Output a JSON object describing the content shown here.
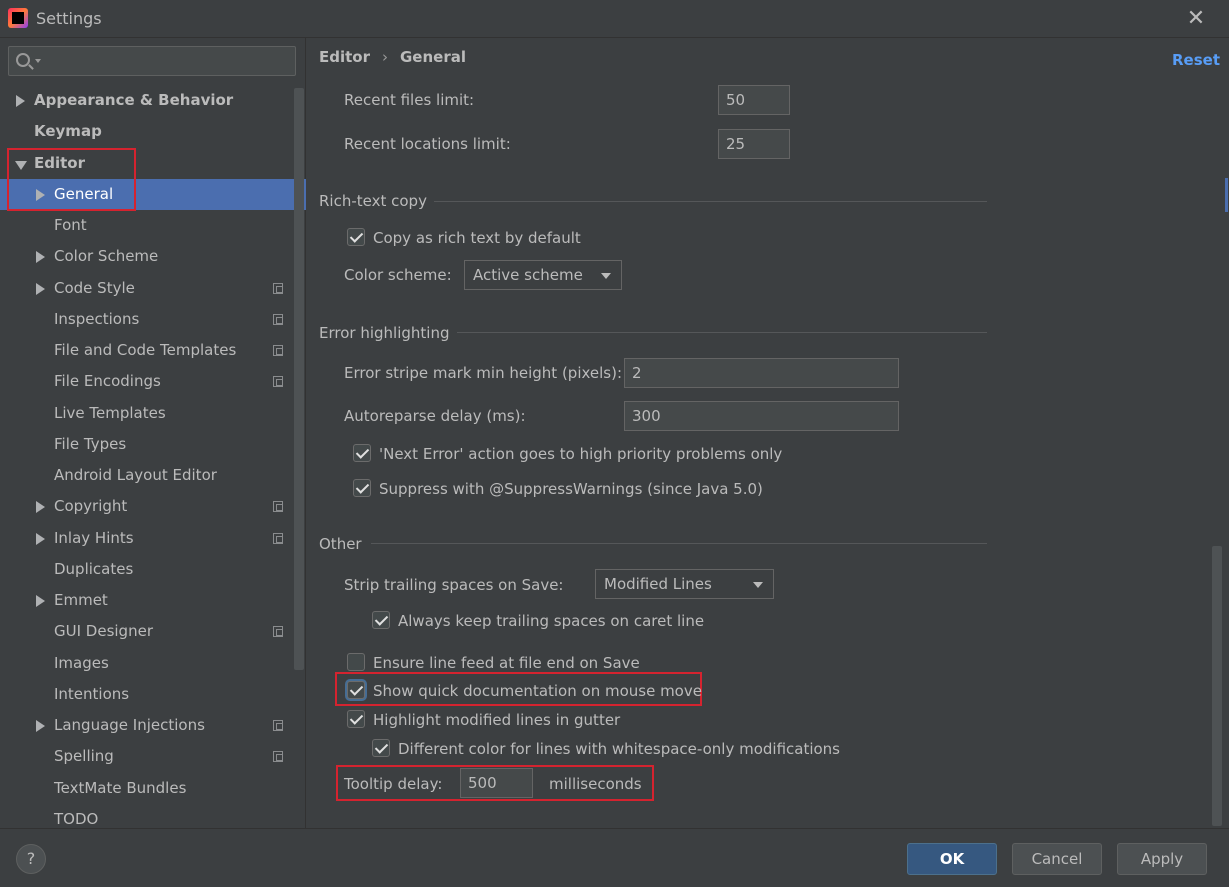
{
  "window": {
    "title": "Settings",
    "close_glyph": "✕",
    "logo": "intellij-logo"
  },
  "search": {
    "value": "",
    "placeholder": ""
  },
  "sidebar": {
    "items": [
      {
        "label": "Appearance & Behavior",
        "depth": 0,
        "bold": true,
        "arrow": "right"
      },
      {
        "label": "Keymap",
        "depth": 0,
        "bold": true,
        "arrow": "none"
      },
      {
        "label": "Editor",
        "depth": 0,
        "bold": true,
        "arrow": "down"
      },
      {
        "label": "General",
        "depth": 1,
        "arrow": "right",
        "selected": true
      },
      {
        "label": "Font",
        "depth": 1,
        "arrow": "none"
      },
      {
        "label": "Color Scheme",
        "depth": 1,
        "arrow": "right"
      },
      {
        "label": "Code Style",
        "depth": 1,
        "arrow": "right",
        "copy": true
      },
      {
        "label": "Inspections",
        "depth": 1,
        "arrow": "none",
        "copy": true
      },
      {
        "label": "File and Code Templates",
        "depth": 1,
        "arrow": "none",
        "copy": true
      },
      {
        "label": "File Encodings",
        "depth": 1,
        "arrow": "none",
        "copy": true
      },
      {
        "label": "Live Templates",
        "depth": 1,
        "arrow": "none"
      },
      {
        "label": "File Types",
        "depth": 1,
        "arrow": "none"
      },
      {
        "label": "Android Layout Editor",
        "depth": 1,
        "arrow": "none"
      },
      {
        "label": "Copyright",
        "depth": 1,
        "arrow": "right",
        "copy": true
      },
      {
        "label": "Inlay Hints",
        "depth": 1,
        "arrow": "right",
        "copy": true
      },
      {
        "label": "Duplicates",
        "depth": 1,
        "arrow": "none"
      },
      {
        "label": "Emmet",
        "depth": 1,
        "arrow": "right"
      },
      {
        "label": "GUI Designer",
        "depth": 1,
        "arrow": "none",
        "copy": true
      },
      {
        "label": "Images",
        "depth": 1,
        "arrow": "none"
      },
      {
        "label": "Intentions",
        "depth": 1,
        "arrow": "none"
      },
      {
        "label": "Language Injections",
        "depth": 1,
        "arrow": "right",
        "copy": true
      },
      {
        "label": "Spelling",
        "depth": 1,
        "arrow": "none",
        "copy": true
      },
      {
        "label": "TextMate Bundles",
        "depth": 1,
        "arrow": "none"
      },
      {
        "label": "TODO",
        "depth": 1,
        "arrow": "none"
      }
    ]
  },
  "breadcrumb": {
    "parent": "Editor",
    "separator": "›",
    "current": "General"
  },
  "reset_label": "Reset",
  "recent": {
    "files_label": "Recent files limit:",
    "files_value": "50",
    "locations_label": "Recent locations limit:",
    "locations_value": "25"
  },
  "rich_text": {
    "title": "Rich-text copy",
    "copy_label": "Copy as rich text by default",
    "scheme_label": "Color scheme:",
    "scheme_value": "Active scheme"
  },
  "error": {
    "title": "Error highlighting",
    "stripe_label": "Error stripe mark min height (pixels):",
    "stripe_value": "2",
    "autoreparse_label": "Autoreparse delay (ms):",
    "autoreparse_value": "300",
    "next_error_label": "'Next Error' action goes to high priority problems only",
    "suppress_label": "Suppress with @SuppressWarnings (since Java 5.0)"
  },
  "other": {
    "title": "Other",
    "strip_label": "Strip trailing spaces on Save:",
    "strip_value": "Modified Lines",
    "keep_label": "Always keep trailing spaces on caret line",
    "line_feed_label": "Ensure line feed at file end on Save",
    "quick_doc_label": "Show quick documentation on mouse move",
    "highlight_label": "Highlight modified lines in gutter",
    "whitespace_label": "Different color for lines with whitespace-only modifications",
    "tooltip_label": "Tooltip delay:",
    "tooltip_value": "500",
    "tooltip_unit": "milliseconds"
  },
  "footer": {
    "help": "?",
    "ok": "OK",
    "cancel": "Cancel",
    "apply": "Apply"
  },
  "colors": {
    "selection": "#4b6eaf",
    "highlight_box": "#d5232f",
    "link": "#589df6",
    "primary_button": "#365880"
  }
}
